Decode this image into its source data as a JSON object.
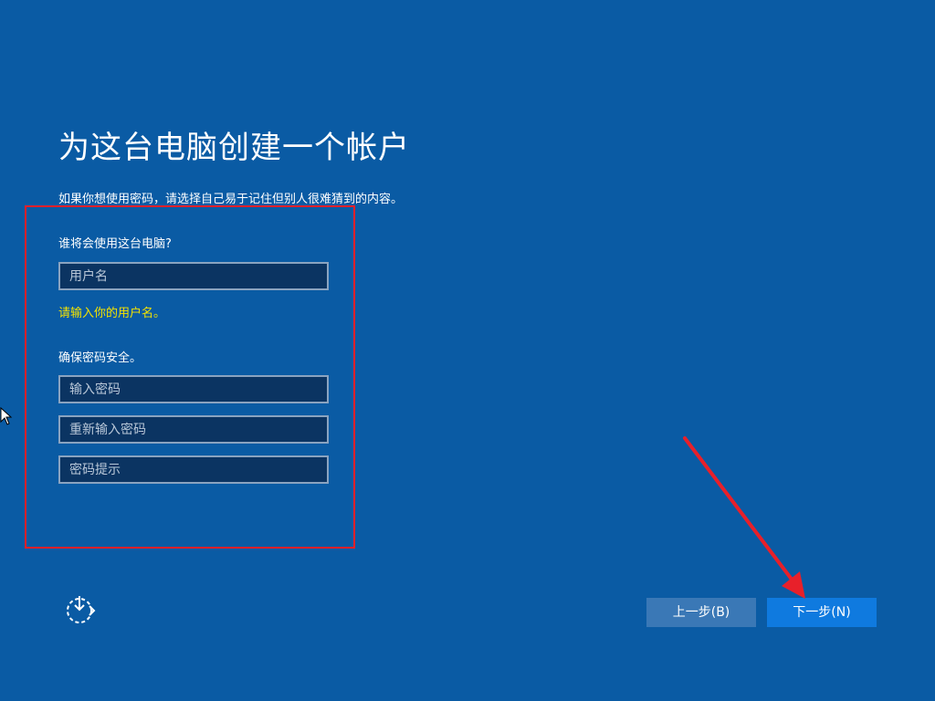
{
  "page": {
    "title": "为这台电脑创建一个帐户",
    "subtitle": "如果你想使用密码，请选择自己易于记住但别人很难猜到的内容。"
  },
  "form": {
    "who_label": "谁将会使用这台电脑?",
    "username_placeholder": "用户名",
    "username_error": "请输入你的用户名。",
    "password_label": "确保密码安全。",
    "password_placeholder": "输入密码",
    "repassword_placeholder": "重新输入密码",
    "hint_placeholder": "密码提示"
  },
  "footer": {
    "back_label": "上一步(B)",
    "next_label": "下一步(N)",
    "accessibility_icon": "ease-of-access-icon"
  },
  "colors": {
    "background": "#0a5ba4",
    "field_bg": "#0b3462",
    "error_text": "#f4e300",
    "annotation": "#e8202a",
    "next_button": "#0f7adf",
    "back_button": "#3a78b6"
  }
}
